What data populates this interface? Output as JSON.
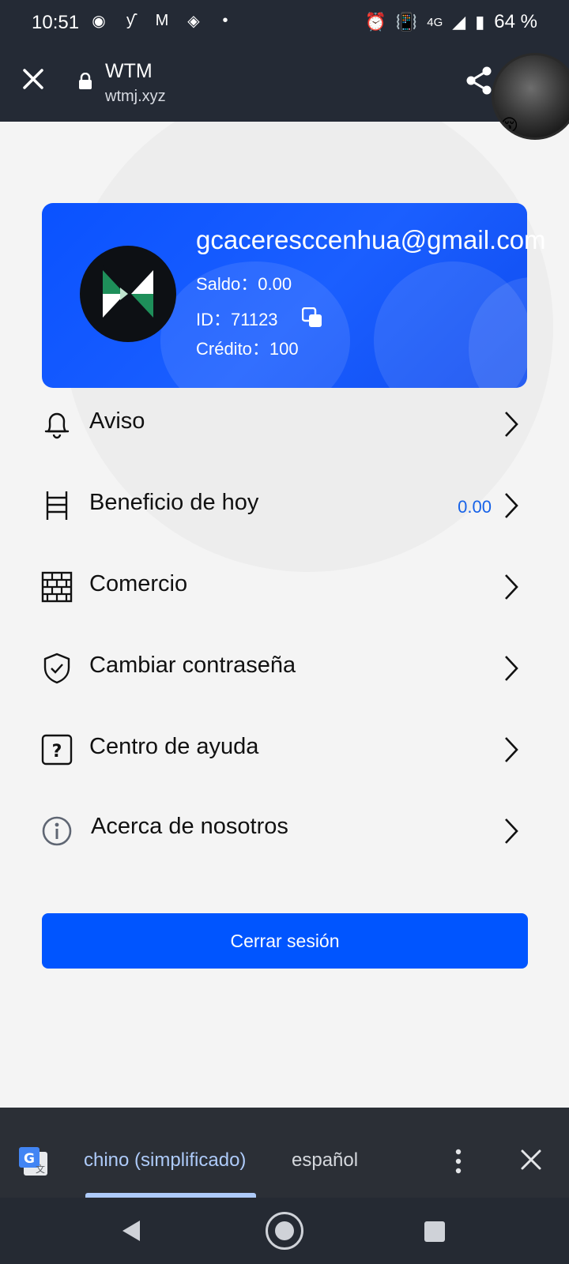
{
  "status_bar": {
    "time": "10:51",
    "network": "4G",
    "battery": "64 %"
  },
  "browser": {
    "title": "WTM",
    "url": "wtmj.xyz"
  },
  "profile": {
    "email": "gcaceresccenhua@gmail.com",
    "balance": "Saldo：0.00",
    "id": "ID：71123",
    "credit": "Crédito：100"
  },
  "menu": [
    {
      "label": "Aviso",
      "value": "",
      "icon": "bell-icon"
    },
    {
      "label": "Beneficio de hoy",
      "value": "0.00",
      "icon": "ladder-icon"
    },
    {
      "label": "Comercio",
      "value": "",
      "icon": "brick-wall-icon"
    },
    {
      "label": "Cambiar contraseña",
      "value": "",
      "icon": "shield-check-icon"
    },
    {
      "label": "Centro de ayuda",
      "value": "",
      "icon": "help-icon"
    },
    {
      "label": "Acerca de nosotros",
      "value": "",
      "icon": "info-icon"
    }
  ],
  "logout_label": "Cerrar sesión",
  "translate_bar": {
    "source_language": "chino (simplificado)",
    "target_language": "español"
  },
  "colors": {
    "accent": "#0055ff",
    "card": "#1b5fff",
    "chrome": "#242a35",
    "value_text": "#1662e8"
  }
}
